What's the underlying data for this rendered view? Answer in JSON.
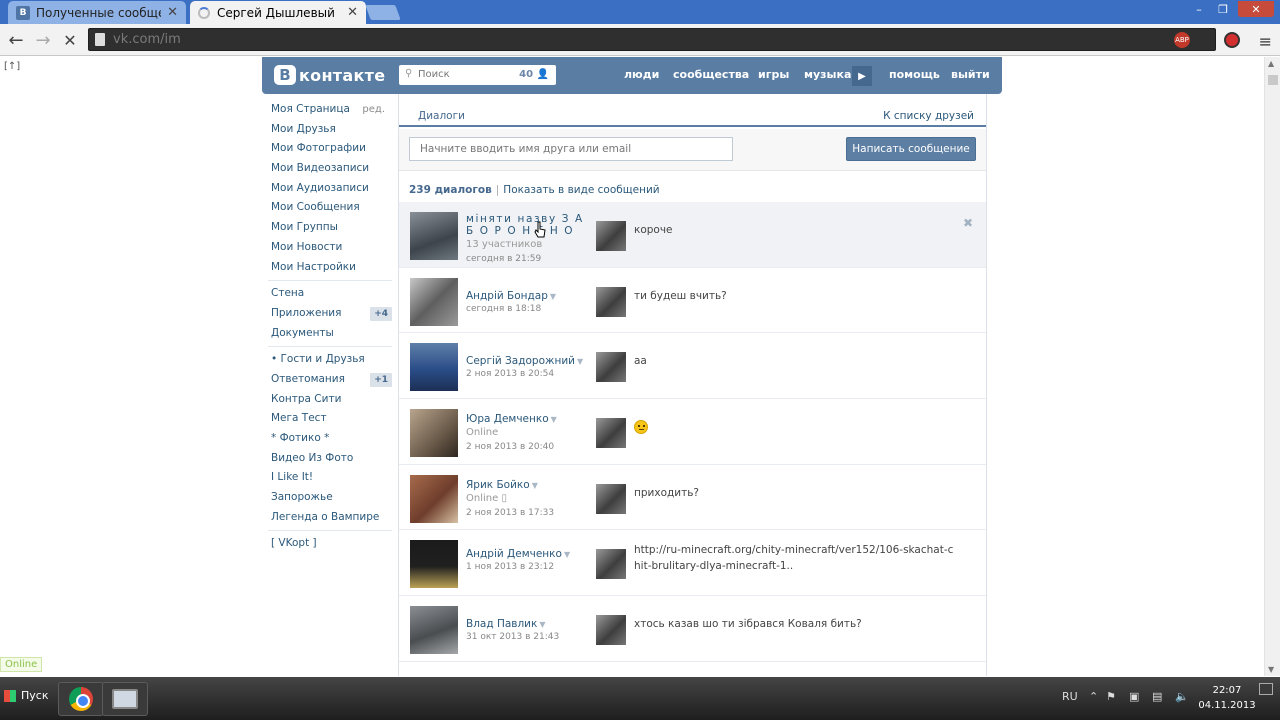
{
  "browser": {
    "tabs": [
      {
        "title": "Полученные сообщения",
        "favicon": "В",
        "state": "inactive"
      },
      {
        "title": "Сергей Дышлевый",
        "state": "active-loading"
      }
    ],
    "url": "vk.com/im",
    "window_buttons": [
      "–",
      "❐",
      "✕"
    ],
    "extensions": [
      {
        "name": "abp-icon",
        "label": "ABP"
      },
      {
        "name": "star-icon"
      },
      {
        "name": "record-icon"
      }
    ]
  },
  "page": {
    "corner_link": "[↑]",
    "online_badge": "Online",
    "header": {
      "logo_letter": "В",
      "logo_word": "контакте",
      "search_placeholder": "Поиск",
      "search_count": "40",
      "nav": [
        "люди",
        "сообщества",
        "игры",
        "музыка",
        "помощь",
        "выйти"
      ]
    },
    "left_menu": {
      "group1": [
        {
          "label": "Моя Страница",
          "aside": "ред."
        },
        {
          "label": "Мои Друзья"
        },
        {
          "label": "Мои Фотографии"
        },
        {
          "label": "Мои Видеозаписи"
        },
        {
          "label": "Мои Аудиозаписи"
        },
        {
          "label": "Мои Сообщения"
        },
        {
          "label": "Мои Группы"
        },
        {
          "label": "Мои Новости"
        },
        {
          "label": "Мои Настройки"
        }
      ],
      "group2": [
        {
          "label": "Стена"
        },
        {
          "label": "Приложения",
          "badge": "+4"
        },
        {
          "label": "Документы"
        }
      ],
      "group3": [
        {
          "label": "• Гости и Друзья"
        },
        {
          "label": "Ответомания",
          "badge": "+1"
        },
        {
          "label": "Контра Сити"
        },
        {
          "label": "Мега Тест"
        },
        {
          "label": "* Фотико *"
        },
        {
          "label": "Видео Из Фото"
        },
        {
          "label": "I Like It!"
        },
        {
          "label": "Запорожье"
        },
        {
          "label": "Легенда о Вампире"
        }
      ],
      "group4": [
        {
          "label": "[ VKopt ]"
        }
      ]
    },
    "content": {
      "tab_dialogs": "Диалоги",
      "tab_friends": "К списку друзей",
      "friend_search_placeholder": "Начните вводить имя друга или email",
      "write_button": "Написать сообщение",
      "summary_count": "239 диалогов",
      "summary_alt": "Показать в виде сообщений",
      "dialogs": [
        {
          "name": "міняти назву З А Б О Р О Н Е Н О",
          "sub": "13 участников",
          "date": "сегодня в 21:59",
          "message": "короче",
          "hovered": true
        },
        {
          "name": "Андрій Бондар",
          "sub": "",
          "date": "сегодня в 18:18",
          "message": "ти будеш вчить?"
        },
        {
          "name": "Сергій Задорожний",
          "sub": "",
          "date": "2 ноя 2013 в 20:54",
          "message": "аа"
        },
        {
          "name": "Юра Демченко",
          "sub": "Online",
          "date": "2 ноя 2013 в 20:40",
          "message": ""
        },
        {
          "name": "Ярик Бойко",
          "sub": "Online",
          "date": "2 ноя 2013 в 17:33",
          "message": "приходить?"
        },
        {
          "name": "Андрій Демченко",
          "sub": "",
          "date": "1 ноя 2013 в 23:12",
          "message": "http://ru-minecraft.org/chity-minecraft/ver152/106-skachat-chit-brulitary-dlya-minecraft-1.."
        },
        {
          "name": "Влад Павлик",
          "sub": "",
          "date": "31 окт 2013 в 21:43",
          "message": "хтось казав шо ти зібрався Коваля бить?"
        }
      ]
    }
  },
  "taskbar": {
    "start_label": "Пуск",
    "lang": "RU",
    "time": "22:07",
    "date": "04.11.2013"
  }
}
